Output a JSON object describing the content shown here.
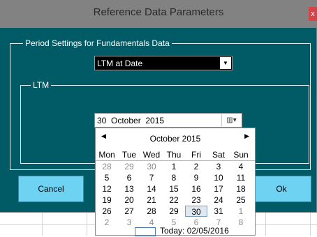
{
  "window": {
    "title": "Reference Data Parameters",
    "close_label": "x"
  },
  "period_settings": {
    "legend": "Period Settings for Fundamentals Data",
    "selected_option": "LTM at Date"
  },
  "ltm": {
    "legend": "LTM",
    "date_value": "30  October  2015"
  },
  "buttons": {
    "cancel": "Cancel",
    "ok": "Ok"
  },
  "calendar": {
    "month_label": "October 2015",
    "prev_glyph": "◀",
    "next_glyph": "▶",
    "weekdays": [
      "Mon",
      "Tue",
      "Wed",
      "Thu",
      "Fri",
      "Sat",
      "Sun"
    ],
    "weeks": [
      [
        {
          "d": "28",
          "o": 1
        },
        {
          "d": "29",
          "o": 1
        },
        {
          "d": "30",
          "o": 1
        },
        {
          "d": "1"
        },
        {
          "d": "2"
        },
        {
          "d": "3"
        },
        {
          "d": "4"
        }
      ],
      [
        {
          "d": "5"
        },
        {
          "d": "6"
        },
        {
          "d": "7"
        },
        {
          "d": "8"
        },
        {
          "d": "9"
        },
        {
          "d": "10"
        },
        {
          "d": "11"
        }
      ],
      [
        {
          "d": "12"
        },
        {
          "d": "13"
        },
        {
          "d": "14"
        },
        {
          "d": "15"
        },
        {
          "d": "16"
        },
        {
          "d": "17"
        },
        {
          "d": "18"
        }
      ],
      [
        {
          "d": "19"
        },
        {
          "d": "20"
        },
        {
          "d": "21"
        },
        {
          "d": "22"
        },
        {
          "d": "23"
        },
        {
          "d": "24"
        },
        {
          "d": "25"
        }
      ],
      [
        {
          "d": "26"
        },
        {
          "d": "27"
        },
        {
          "d": "28"
        },
        {
          "d": "29"
        },
        {
          "d": "30",
          "s": 1
        },
        {
          "d": "31"
        },
        {
          "d": "1",
          "o": 1
        }
      ],
      [
        {
          "d": "2",
          "o": 1
        },
        {
          "d": "3",
          "o": 1
        },
        {
          "d": "4",
          "o": 1
        },
        {
          "d": "5",
          "o": 1
        },
        {
          "d": "6",
          "o": 1
        },
        {
          "d": "7",
          "o": 1
        },
        {
          "d": "8",
          "o": 1
        }
      ]
    ],
    "today_label": "Today: 02/05/2016"
  },
  "icons": {
    "combo_arrow": "dropdown-arrow-icon",
    "date_picker": "calendar-icon"
  },
  "colors": {
    "dialog_bg": "#005b67",
    "title_bar": "#828282",
    "button_bg": "#6ed2f2",
    "close_btn": "#d64545"
  }
}
